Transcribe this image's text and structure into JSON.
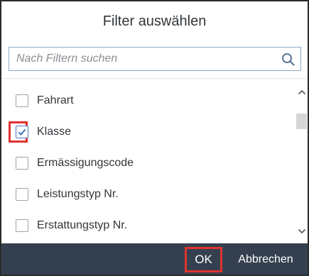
{
  "dialog": {
    "title": "Filter auswählen",
    "search": {
      "placeholder": "Nach Filtern suchen",
      "value": "",
      "icon": "search-icon"
    },
    "items": [
      {
        "label": "Fahrart",
        "checked": false
      },
      {
        "label": "Klasse",
        "checked": true,
        "highlighted": true
      },
      {
        "label": "Ermässigungscode",
        "checked": false
      },
      {
        "label": "Leistungstyp Nr.",
        "checked": false
      },
      {
        "label": "Erstattungstyp Nr.",
        "checked": false
      }
    ],
    "footer": {
      "ok_label": "OK",
      "cancel_label": "Abbrechen"
    }
  },
  "colors": {
    "footer_bg": "#34404f",
    "highlight": "#e0332f",
    "search_border": "#8ea9c8",
    "checkbox_check": "#3a73b5"
  }
}
